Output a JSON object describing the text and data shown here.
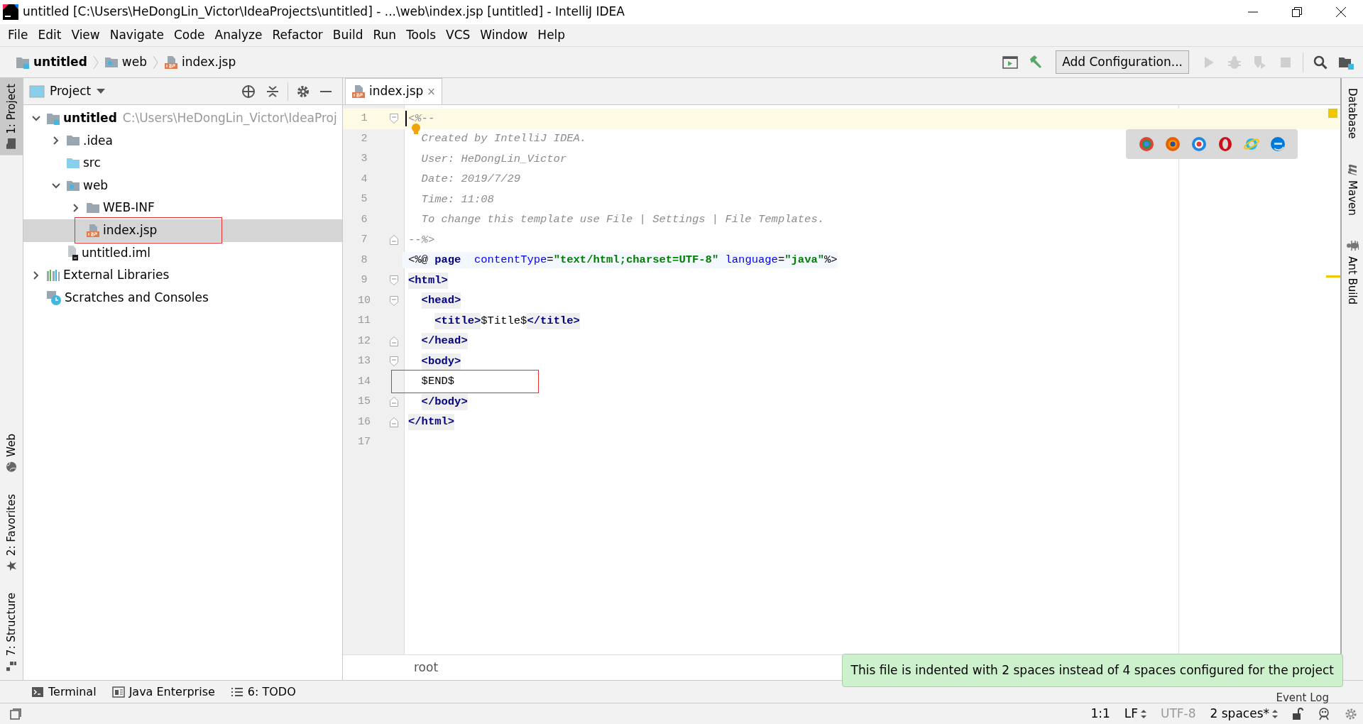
{
  "window": {
    "title": "untitled [C:\\Users\\HeDongLin_Victor\\IdeaProjects\\untitled] - ...\\web\\index.jsp [untitled] - IntelliJ IDEA"
  },
  "menu": [
    "File",
    "Edit",
    "View",
    "Navigate",
    "Code",
    "Analyze",
    "Refactor",
    "Build",
    "Run",
    "Tools",
    "VCS",
    "Window",
    "Help"
  ],
  "breadcrumbs": [
    {
      "label": "untitled",
      "kind": "module"
    },
    {
      "label": "web",
      "kind": "web-folder"
    },
    {
      "label": "index.jsp",
      "kind": "jsp-file"
    }
  ],
  "toolbar": [
    {
      "kind": "run-window",
      "disabled": false
    },
    {
      "kind": "build",
      "disabled": false
    },
    {
      "kind": "config",
      "label": "Add Configuration...",
      "disabled": false
    },
    {
      "kind": "run",
      "disabled": true
    },
    {
      "kind": "debug",
      "disabled": true
    },
    {
      "kind": "coverage",
      "disabled": true
    },
    {
      "kind": "stop",
      "disabled": true
    },
    {
      "kind": "search",
      "disabled": false
    },
    {
      "kind": "structure",
      "disabled": false
    }
  ],
  "left_strip": [
    {
      "label": "1: Project",
      "selected": true,
      "kind": "folder"
    },
    {
      "label": "Web",
      "selected": false,
      "kind": "globe"
    },
    {
      "label": "2: Favorites",
      "selected": false,
      "kind": "star"
    },
    {
      "label": "7: Structure",
      "selected": false,
      "kind": "structure"
    }
  ],
  "right_strip": [
    {
      "label": "Database",
      "kind": "none"
    },
    {
      "label": "Maven",
      "kind": "maven"
    },
    {
      "label": "Ant Build",
      "kind": "ant"
    }
  ],
  "project": {
    "title": "Project",
    "tree": [
      {
        "label": "untitled",
        "hint": "C:\\Users\\HeDongLin_Victor\\IdeaProj",
        "kind": "module",
        "expanded": true,
        "selected": false,
        "children": [
          {
            "label": ".idea",
            "kind": "folder",
            "expanded": false,
            "selected": false
          },
          {
            "label": "src",
            "kind": "source-folder",
            "selected": false
          },
          {
            "label": "web",
            "kind": "web-folder",
            "expanded": true,
            "selected": false,
            "children": [
              {
                "label": "WEB-INF",
                "kind": "folder",
                "expanded": false,
                "selected": false
              },
              {
                "label": "index.jsp",
                "kind": "jsp-file",
                "selected": true,
                "highlighted": true
              }
            ]
          },
          {
            "label": "untitled.iml",
            "kind": "iml-file",
            "selected": false
          }
        ]
      },
      {
        "label": "External Libraries",
        "kind": "libraries",
        "expanded": false,
        "selected": false
      },
      {
        "label": "Scratches and Consoles",
        "kind": "scratches",
        "selected": false
      }
    ]
  },
  "editor": {
    "tab": {
      "label": "index.jsp",
      "close": "×",
      "selected": true
    },
    "lines": [
      {
        "number": "1",
        "fold_start": true,
        "current": true,
        "tokens": [
          {
            "text": "<%--",
            "kind": "comment"
          }
        ]
      },
      {
        "number": "2",
        "intention": true,
        "tokens": [
          {
            "text": "  Created by IntelliJ IDEA.",
            "kind": "comment"
          }
        ]
      },
      {
        "number": "3",
        "tokens": [
          {
            "text": "  User: HeDongLin_Victor",
            "kind": "comment"
          }
        ]
      },
      {
        "number": "4",
        "tokens": [
          {
            "text": "  Date: 2019/7/29",
            "kind": "comment"
          }
        ]
      },
      {
        "number": "5",
        "tokens": [
          {
            "text": "  Time: 11:08",
            "kind": "comment"
          }
        ]
      },
      {
        "number": "6",
        "tokens": [
          {
            "text": "  To change this template use File | Settings | File Templates.",
            "kind": "comment"
          }
        ]
      },
      {
        "number": "7",
        "fold_end": true,
        "tokens": [
          {
            "text": "--%>",
            "kind": "comment"
          }
        ]
      },
      {
        "number": "8",
        "kind": "directive",
        "tokens": [
          {
            "text": "<%@",
            "kind": "plain"
          },
          {
            "text": "page",
            "kind": "keyword"
          },
          {
            "text": "contentType",
            "kind": "attr"
          },
          {
            "text": "=",
            "kind": "plain"
          },
          {
            "text": "\"text/html;charset=UTF-8\"",
            "kind": "string"
          },
          {
            "text": "language",
            "kind": "attr"
          },
          {
            "text": "=",
            "kind": "plain"
          },
          {
            "text": "\"java\"",
            "kind": "string"
          },
          {
            "text": "%>",
            "kind": "plain"
          }
        ]
      },
      {
        "number": "9",
        "fold_start": true,
        "tokens": [
          {
            "text": "<html>",
            "kind": "tag"
          }
        ]
      },
      {
        "number": "10",
        "fold_start": true,
        "tokens": [
          {
            "text": "  <head>",
            "kind": "tag"
          }
        ]
      },
      {
        "number": "11",
        "tokens": [
          {
            "text": "    <title>",
            "kind": "tag"
          },
          {
            "text": "$Title$",
            "kind": "plain"
          },
          {
            "text": "</title>",
            "kind": "tag"
          }
        ]
      },
      {
        "number": "12",
        "fold_end": true,
        "tokens": [
          {
            "text": "  </head>",
            "kind": "tag"
          }
        ]
      },
      {
        "number": "13",
        "fold_start": true,
        "tokens": [
          {
            "text": "  <body>",
            "kind": "tag"
          }
        ]
      },
      {
        "number": "14",
        "highlighted": true,
        "tokens": [
          {
            "text": "  $END$",
            "kind": "plain"
          }
        ]
      },
      {
        "number": "15",
        "fold_end": true,
        "tokens": [
          {
            "text": "  </body>",
            "kind": "tag"
          }
        ]
      },
      {
        "number": "16",
        "fold_end": true,
        "tokens": [
          {
            "text": "</html>",
            "kind": "tag"
          }
        ]
      },
      {
        "number": "17"
      }
    ],
    "breadcrumb": "root"
  },
  "bottom_tabs": [
    {
      "label": "Terminal",
      "kind": "terminal"
    },
    {
      "label": "Java Enterprise",
      "kind": "enterprise"
    },
    {
      "label": "6: TODO",
      "kind": "todo"
    }
  ],
  "notification": "This file is indented with 2 spaces instead of 4 spaces configured for the project",
  "status_bar": {
    "event_log": "Event Log",
    "items": [
      {
        "label": "1:1",
        "disabled": false,
        "arrows": false
      },
      {
        "label": "LF",
        "disabled": false,
        "arrows": true
      },
      {
        "label": "UTF-8",
        "disabled": true,
        "arrows": false
      },
      {
        "label": "2 spaces*",
        "disabled": false,
        "arrows": true
      }
    ]
  }
}
